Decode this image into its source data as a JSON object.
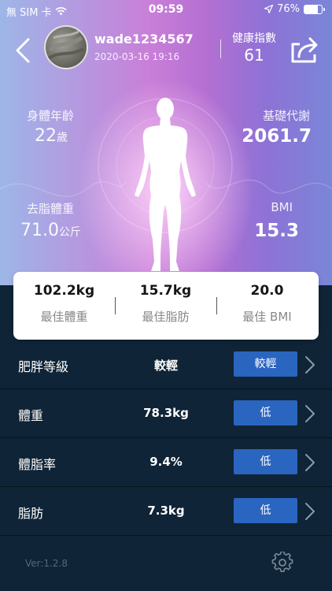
{
  "status_bar": {
    "carrier": "無 SIM 卡",
    "time": "09:59",
    "battery_text": "76%",
    "battery_level": 0.76
  },
  "header": {
    "username": "wade1234567",
    "datetime": "2020-03-16 19:16",
    "health_index_label": "健康指數",
    "health_index_value": "61"
  },
  "metrics": {
    "body_age": {
      "label": "身體年齡",
      "value": "22",
      "unit": "歲"
    },
    "bmr": {
      "label": "基礎代謝",
      "value": "2061.7"
    },
    "lean_mass": {
      "label": "去脂體重",
      "value": "71.0",
      "unit": "公斤"
    },
    "bmi": {
      "label": "BMI",
      "value": "15.3"
    }
  },
  "summary": [
    {
      "value": "102.2kg",
      "label": "最佳體重"
    },
    {
      "value": "15.7kg",
      "label": "最佳脂肪"
    },
    {
      "value": "20.0",
      "label": "最佳 BMI"
    }
  ],
  "rows": [
    {
      "label": "肥胖等級",
      "value": "較輕",
      "badge": "較輕"
    },
    {
      "label": "體重",
      "value": "78.3kg",
      "badge": "低"
    },
    {
      "label": "體脂率",
      "value": "9.4%",
      "badge": "低"
    },
    {
      "label": "脂肪",
      "value": "7.3kg",
      "badge": "低"
    }
  ],
  "footer": {
    "version": "Ver:1.2.8"
  },
  "icons": {
    "back": "chevron-left-icon",
    "share": "share-icon",
    "settings": "gear-icon",
    "row_arrow": "chevron-right-icon"
  },
  "colors": {
    "badge": "#2a65c0",
    "background": "#0f2436",
    "hero_left": "#9db6e8",
    "hero_mid": "#c97fd8",
    "hero_right": "#7a86d8"
  }
}
